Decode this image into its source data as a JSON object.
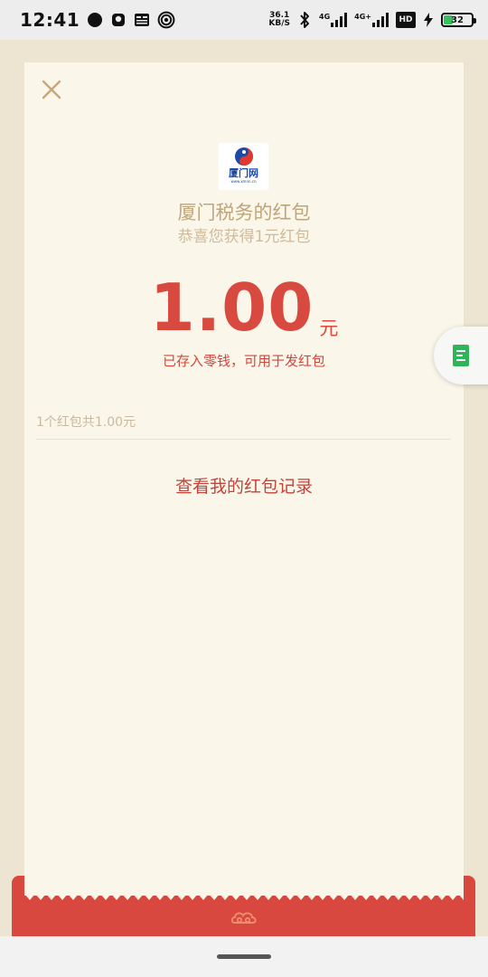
{
  "status_bar": {
    "time": "12:41",
    "net_speed_value": "36.1",
    "net_speed_unit": "KB/S",
    "signal1_label": "4G",
    "signal2_label": "4G+",
    "hd_label": "HD",
    "battery_level": "32",
    "battery_color": "#36c15c",
    "icons": [
      "circle-icon",
      "ghost-icon",
      "news-icon",
      "hotspot-icon",
      "bluetooth-icon",
      "signal-icon",
      "signal-icon",
      "hd-icon",
      "charging-icon",
      "battery-icon"
    ]
  },
  "card": {
    "close_icon": "close-icon",
    "logo": {
      "text": "厦门网",
      "url": "www.xmnn.cn"
    },
    "sender_name": "厦门税务的红包",
    "greeting": "恭喜您获得1元红包",
    "amount": "1.00",
    "amount_unit": "元",
    "deposit_note": "已存入零钱，可用于发红包",
    "summary": "1个红包共1.00元",
    "record_link": "查看我的红包记录"
  },
  "float_widget": {
    "icon": "document-icon",
    "color": "#2fb45a"
  },
  "envelope": {
    "color": "#d8483f",
    "emblem_icon": "cloud-emblem-icon"
  },
  "colors": {
    "accent_red": "#d84a3f",
    "gold_text": "#bfa67a",
    "card_bg": "#faf6ea",
    "page_bg": "#ede5d2"
  }
}
